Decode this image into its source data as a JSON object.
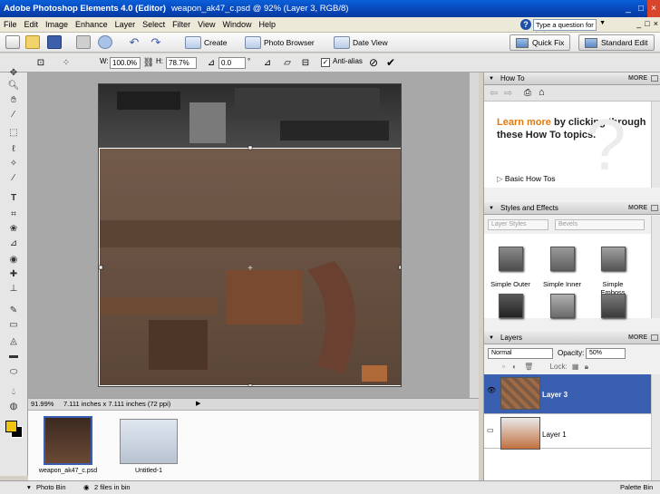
{
  "titlebar": {
    "app_title": "Adobe Photoshop Elements 4.0 (Editor)",
    "doc_title": "weapon_ak47_c.psd @ 92% (Layer 3, RGB/8)",
    "min": "_",
    "max": "□",
    "close": "×"
  },
  "menu": {
    "items": [
      "File",
      "Edit",
      "Image",
      "Enhance",
      "Layer",
      "Select",
      "Filter",
      "View",
      "Window",
      "Help"
    ],
    "help_placeholder": "Type a question for help"
  },
  "shortcuts": {
    "create": "Create",
    "photo_browser": "Photo Browser",
    "date_view": "Date View",
    "quick_fix": "Quick Fix",
    "standard_edit": "Standard Edit"
  },
  "options": {
    "w_label": "W:",
    "w_value": "100.0%",
    "h_label": "H:",
    "h_value": "78.7%",
    "angle_value": "0.0",
    "degree": "°",
    "antialias_label": "Anti-alias",
    "antialias_checked": true
  },
  "status": {
    "zoom": "91.99%",
    "doc_size": "7.111 inches x 7.111 inches (72 ppi)"
  },
  "bin": {
    "items": [
      "weapon_ak47_c.psd",
      "Untitled-1"
    ]
  },
  "statusbar": {
    "photo_bin": "Photo Bin",
    "files_in_bin": "2 files in bin",
    "palette_bin": "Palette Bin"
  },
  "howto": {
    "title": "How To",
    "more": "MORE",
    "accent": "Learn more",
    "rest": " by clicking through these How To topics.",
    "basic": "Basic How Tos"
  },
  "styles": {
    "title": "Styles and Effects",
    "more": "MORE",
    "category": "Layer Styles",
    "library": "Bevels",
    "tiles": [
      "Simple Outer",
      "Simple Inner",
      "Simple Emboss"
    ]
  },
  "layers": {
    "title": "Layers",
    "more": "MORE",
    "blend_mode": "Normal",
    "opacity_label": "Opacity:",
    "opacity_value": "50%",
    "lock_label": "Lock:",
    "rows": [
      "Layer 3",
      "Layer 1"
    ]
  },
  "colors": {
    "accent": "#e07a10",
    "layer_selected": "#3a5fb0",
    "foreground": "#f1c40f",
    "background": "#000000"
  }
}
